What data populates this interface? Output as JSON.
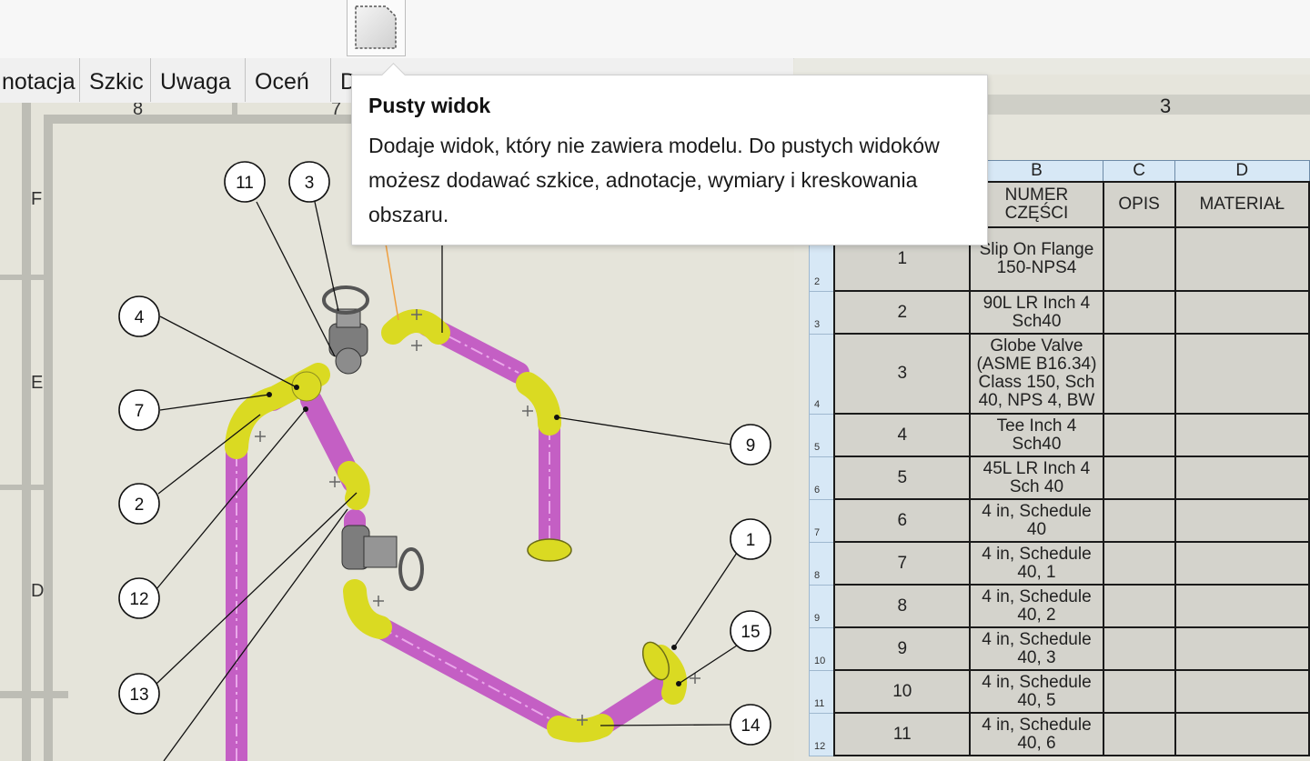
{
  "toolbar": {
    "blank_view_icon": "blank-view-icon"
  },
  "tabs": [
    {
      "label": "notacja"
    },
    {
      "label": "Szkic"
    },
    {
      "label": "Uwaga"
    },
    {
      "label": "Oceń"
    },
    {
      "label": "D"
    }
  ],
  "tooltip": {
    "title": "Pusty widok",
    "body": "Dodaje widok, który nie zawiera modelu. Do pustych widoków możesz dodawać szkice, adnotacje, wymiary i kreskowania obszaru."
  },
  "drawing": {
    "zone_numbers": [
      "8",
      "7"
    ],
    "zone_letters": [
      "F",
      "E",
      "D"
    ],
    "balloons": [
      "11",
      "3",
      "4",
      "7",
      "2",
      "12",
      "13",
      "9",
      "1",
      "15",
      "14"
    ],
    "colors": {
      "pipe": "#c966c9",
      "fitting": "#e3e32a",
      "valve": "#8a8a8a",
      "frame": "#bdbdb5"
    }
  },
  "right_panel": {
    "zone_number": "3"
  },
  "bom": {
    "column_letters": [
      "B",
      "C",
      "D"
    ],
    "headers": [
      "NUMER CZĘŚCI",
      "OPIS",
      "MATERIAŁ"
    ],
    "rows": [
      {
        "row": "2",
        "item": "1",
        "part": "Slip On Flange 150-NPS4"
      },
      {
        "row": "3",
        "item": "2",
        "part": "90L LR Inch 4 Sch40"
      },
      {
        "row": "4",
        "item": "3",
        "part": "Globe Valve (ASME B16.34) Class 150, Sch 40, NPS 4, BW"
      },
      {
        "row": "5",
        "item": "4",
        "part": "Tee Inch 4 Sch40"
      },
      {
        "row": "6",
        "item": "5",
        "part": "45L LR Inch 4 Sch 40"
      },
      {
        "row": "7",
        "item": "6",
        "part": "4 in, Schedule 40"
      },
      {
        "row": "8",
        "item": "7",
        "part": "4 in, Schedule 40, 1"
      },
      {
        "row": "9",
        "item": "8",
        "part": "4 in, Schedule 40, 2"
      },
      {
        "row": "10",
        "item": "9",
        "part": "4 in, Schedule 40, 3"
      },
      {
        "row": "11",
        "item": "10",
        "part": "4 in, Schedule 40, 5"
      },
      {
        "row": "12",
        "item": "11",
        "part": "4 in, Schedule 40, 6"
      }
    ]
  }
}
